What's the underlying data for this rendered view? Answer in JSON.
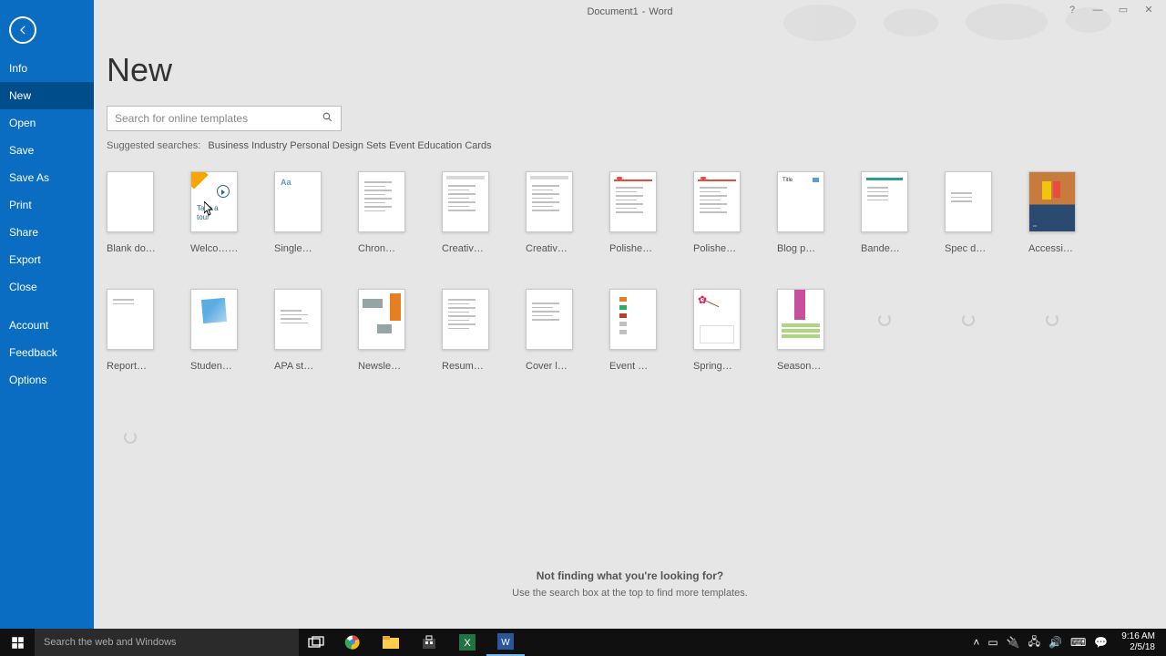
{
  "titlebar": {
    "doc": "Document1",
    "app": "Word"
  },
  "sidebar": {
    "items": [
      "Info",
      "New",
      "Open",
      "Save",
      "Save As",
      "Print",
      "Share",
      "Export",
      "Close"
    ],
    "bottom": [
      "Account",
      "Feedback",
      "Options"
    ],
    "active_index": 1
  },
  "page_title": "New",
  "search": {
    "placeholder": "Search for online templates"
  },
  "suggested": {
    "label": "Suggested searches:",
    "items": [
      "Business",
      "Industry",
      "Personal",
      "Design Sets",
      "Event",
      "Education",
      "Cards"
    ]
  },
  "templates": [
    {
      "label": "Blank do…",
      "kind": "blank"
    },
    {
      "label": "Welco…",
      "kind": "welcome",
      "tour_text": "Take a\ntour",
      "pinned": true
    },
    {
      "label": "Single…",
      "kind": "aa"
    },
    {
      "label": "Chron…",
      "kind": "chron"
    },
    {
      "label": "Creativ…",
      "kind": "creativ"
    },
    {
      "label": "Creativ…",
      "kind": "creativ"
    },
    {
      "label": "Polishe…",
      "kind": "polish"
    },
    {
      "label": "Polishe…",
      "kind": "polish"
    },
    {
      "label": "Blog p…",
      "kind": "blog",
      "title_text": "Title"
    },
    {
      "label": "Bande…",
      "kind": "banded"
    },
    {
      "label": "Spec d…",
      "kind": "spec"
    },
    {
      "label": "Accessi…",
      "kind": "accessi"
    },
    {
      "label": "Report…",
      "kind": "report"
    },
    {
      "label": "Studen…",
      "kind": "student"
    },
    {
      "label": "APA st…",
      "kind": "apa"
    },
    {
      "label": "Newsle…",
      "kind": "newsle"
    },
    {
      "label": "Resum…",
      "kind": "resume"
    },
    {
      "label": "Cover l…",
      "kind": "cover"
    },
    {
      "label": "Event …",
      "kind": "event"
    },
    {
      "label": "Spring…",
      "kind": "spring"
    },
    {
      "label": "Season…",
      "kind": "season"
    },
    {
      "label": "",
      "kind": "loading"
    },
    {
      "label": "",
      "kind": "loading"
    },
    {
      "label": "",
      "kind": "loading"
    },
    {
      "label": "",
      "kind": "loading"
    }
  ],
  "not_finding": {
    "title": "Not finding what you're looking for?",
    "sub": "Use the search box at the top to find more templates."
  },
  "taskbar": {
    "cortana_placeholder": "Search the web and Windows",
    "time": "9:16 AM",
    "date": "2/5/18"
  }
}
